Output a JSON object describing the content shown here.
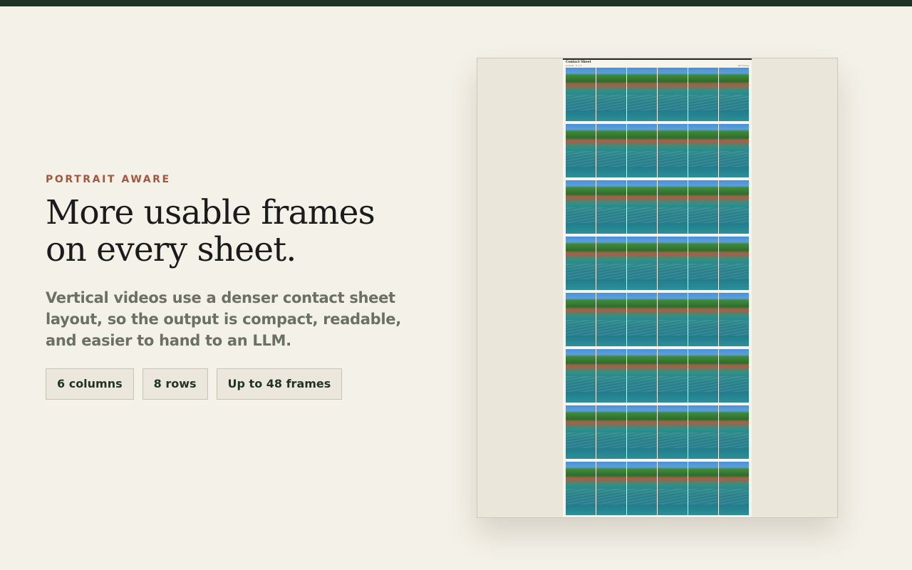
{
  "eyebrow": "PORTRAIT AWARE",
  "headline": {
    "line1": "More usable frames",
    "line2": "on every sheet."
  },
  "subtitle": "Vertical videos use a denser contact sheet layout, so the output is compact, readable, and easier to hand to an LLM.",
  "chips": [
    {
      "label": "6 columns"
    },
    {
      "label": "8 rows"
    },
    {
      "label": "Up to 48 frames"
    }
  ],
  "colors": {
    "background": "#f4f1e8",
    "topbar": "#1f3426",
    "accent": "#a5553c",
    "headline": "#1b1b1b",
    "subtitle": "#6b7064",
    "chip_text": "#1f3426",
    "water": "#1f7d86",
    "sky": "#4a90d6",
    "trees": "#2e6e2c"
  },
  "sheet": {
    "title": "Contact Sheet",
    "meta": "portrait · 6 × 8",
    "note": "48 frames",
    "columns": 6,
    "rows": 8,
    "frame_count": 48
  }
}
